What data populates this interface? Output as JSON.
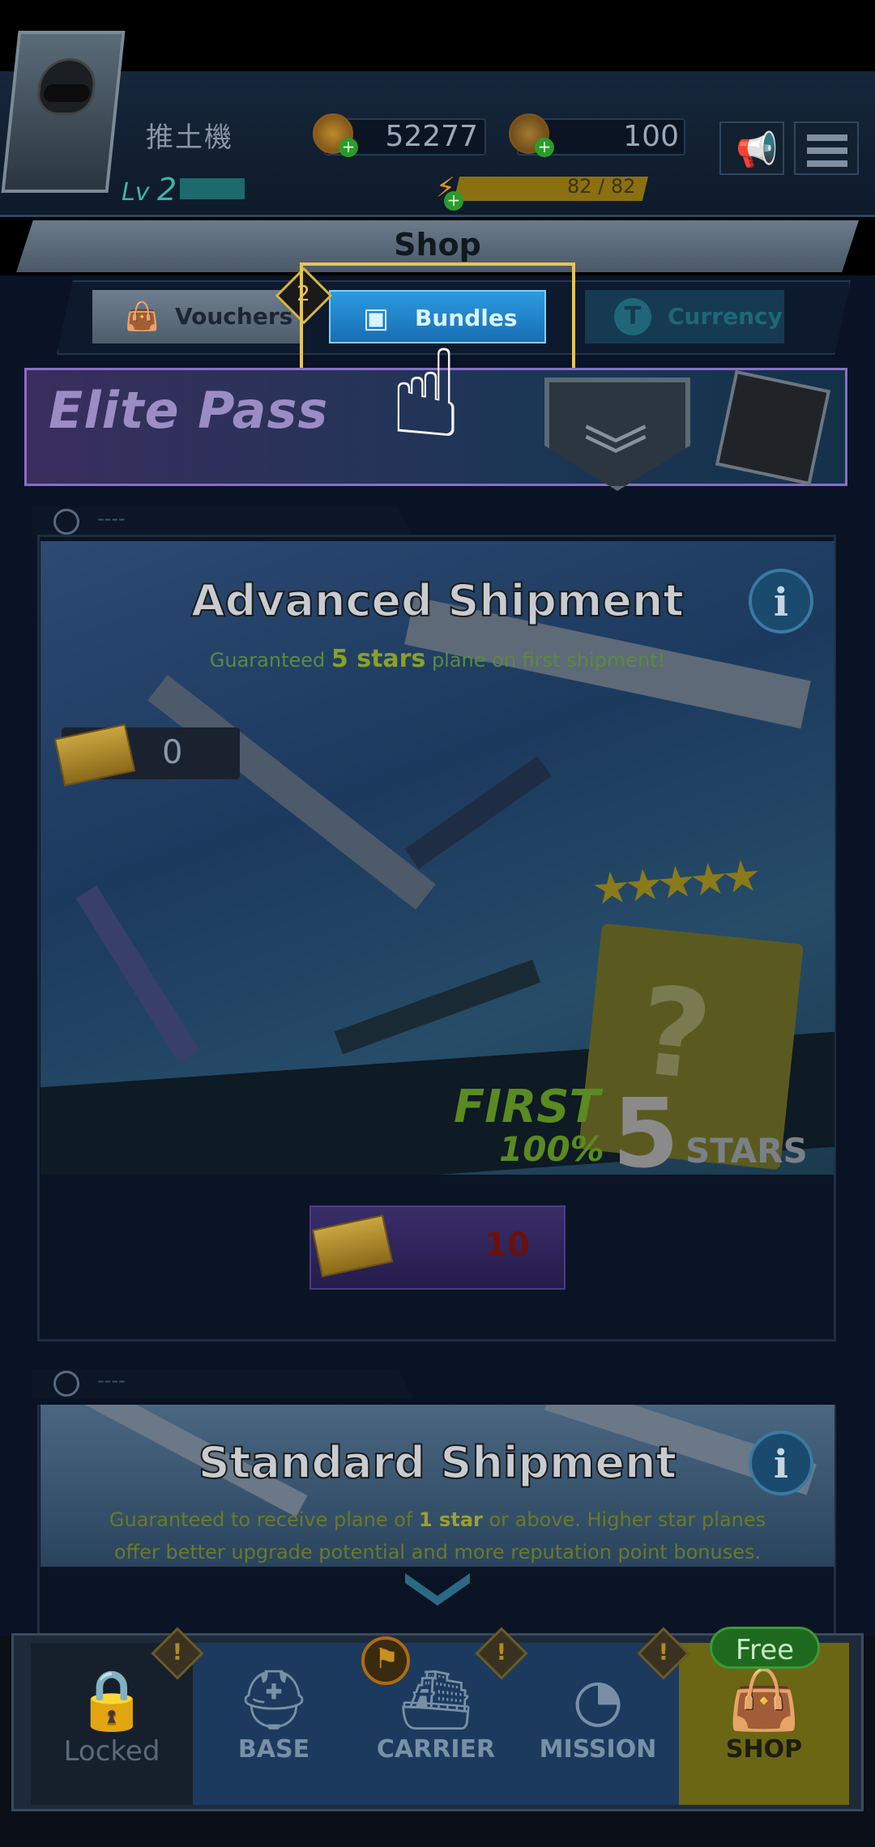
{
  "player": {
    "name": "推土機",
    "level_prefix": "Lv",
    "level": "2",
    "coins": "52277",
    "tickets": "100",
    "energy": "82 / 82",
    "energy_fraction": 1.0,
    "xp_fraction": 0.13
  },
  "shop": {
    "title": "Shop",
    "tabs": [
      {
        "label": "Vouchers",
        "icon": "bag-icon"
      },
      {
        "label": "Bundles",
        "icon": "bundle-icon",
        "selected": true
      },
      {
        "label": "Currency",
        "icon": "ticket-coin-icon"
      }
    ],
    "tab_badge": "2",
    "elite_pass": "Elite Pass"
  },
  "cards": [
    {
      "timer": "----",
      "title": "Advanced Shipment",
      "subtitle_pre": "Guaranteed ",
      "subtitle_highlight": "5 stars",
      "subtitle_post": " plane on first shipment!",
      "owned_count": "0",
      "stars": "★★★★★",
      "mystery": "?",
      "promo_first": "FIRST",
      "promo_pct": "100%",
      "promo_five": "5",
      "promo_stars": "STARS",
      "price": "10"
    },
    {
      "timer": "----",
      "title": "Standard Shipment",
      "subtitle_pre": "Guaranteed to receive plane of ",
      "subtitle_highlight": "1 star",
      "subtitle_post": " or above. Higher star planes",
      "subtitle_line2": "offer better upgrade potential and more reputation point bonuses."
    }
  ],
  "nav": {
    "free_label": "Free",
    "items": [
      {
        "label": "Locked",
        "icon": "lock-icon"
      },
      {
        "label": "BASE",
        "icon": "helmet-icon"
      },
      {
        "label": "CARRIER",
        "icon": "carrier-icon"
      },
      {
        "label": "MISSION",
        "icon": "radar-icon"
      },
      {
        "label": "SHOP",
        "icon": "shop-bag-icon"
      }
    ],
    "alert": "!"
  },
  "colors": {
    "selected_tab": "#2b9be0",
    "highlight_frame": "#e2c65a",
    "shop_nav": "#6a6614"
  }
}
